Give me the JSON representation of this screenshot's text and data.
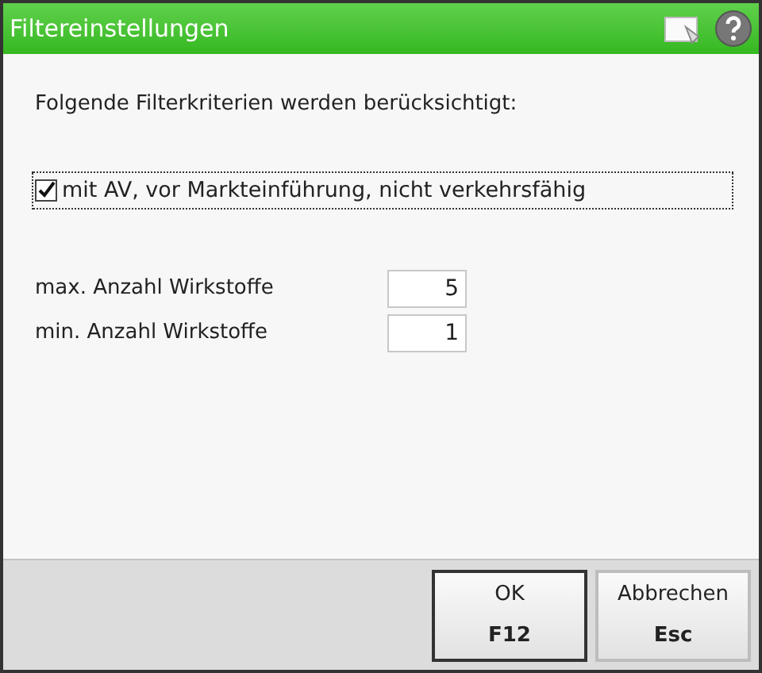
{
  "window": {
    "title": "Filtereinstellungen"
  },
  "intro": "Folgende Filterkriterien werden berücksichtigt:",
  "criterion": {
    "label": "mit AV, vor Markteinführung, nicht verkehrsfähig",
    "checked": true
  },
  "fields": [
    {
      "label": "max. Anzahl Wirkstoffe",
      "value": "5"
    },
    {
      "label": "min. Anzahl Wirkstoffe",
      "value": "1"
    }
  ],
  "buttons": [
    {
      "label": "OK",
      "key": "F12",
      "default": true
    },
    {
      "label": "Abbrechen",
      "key": "Esc",
      "default": false
    }
  ]
}
